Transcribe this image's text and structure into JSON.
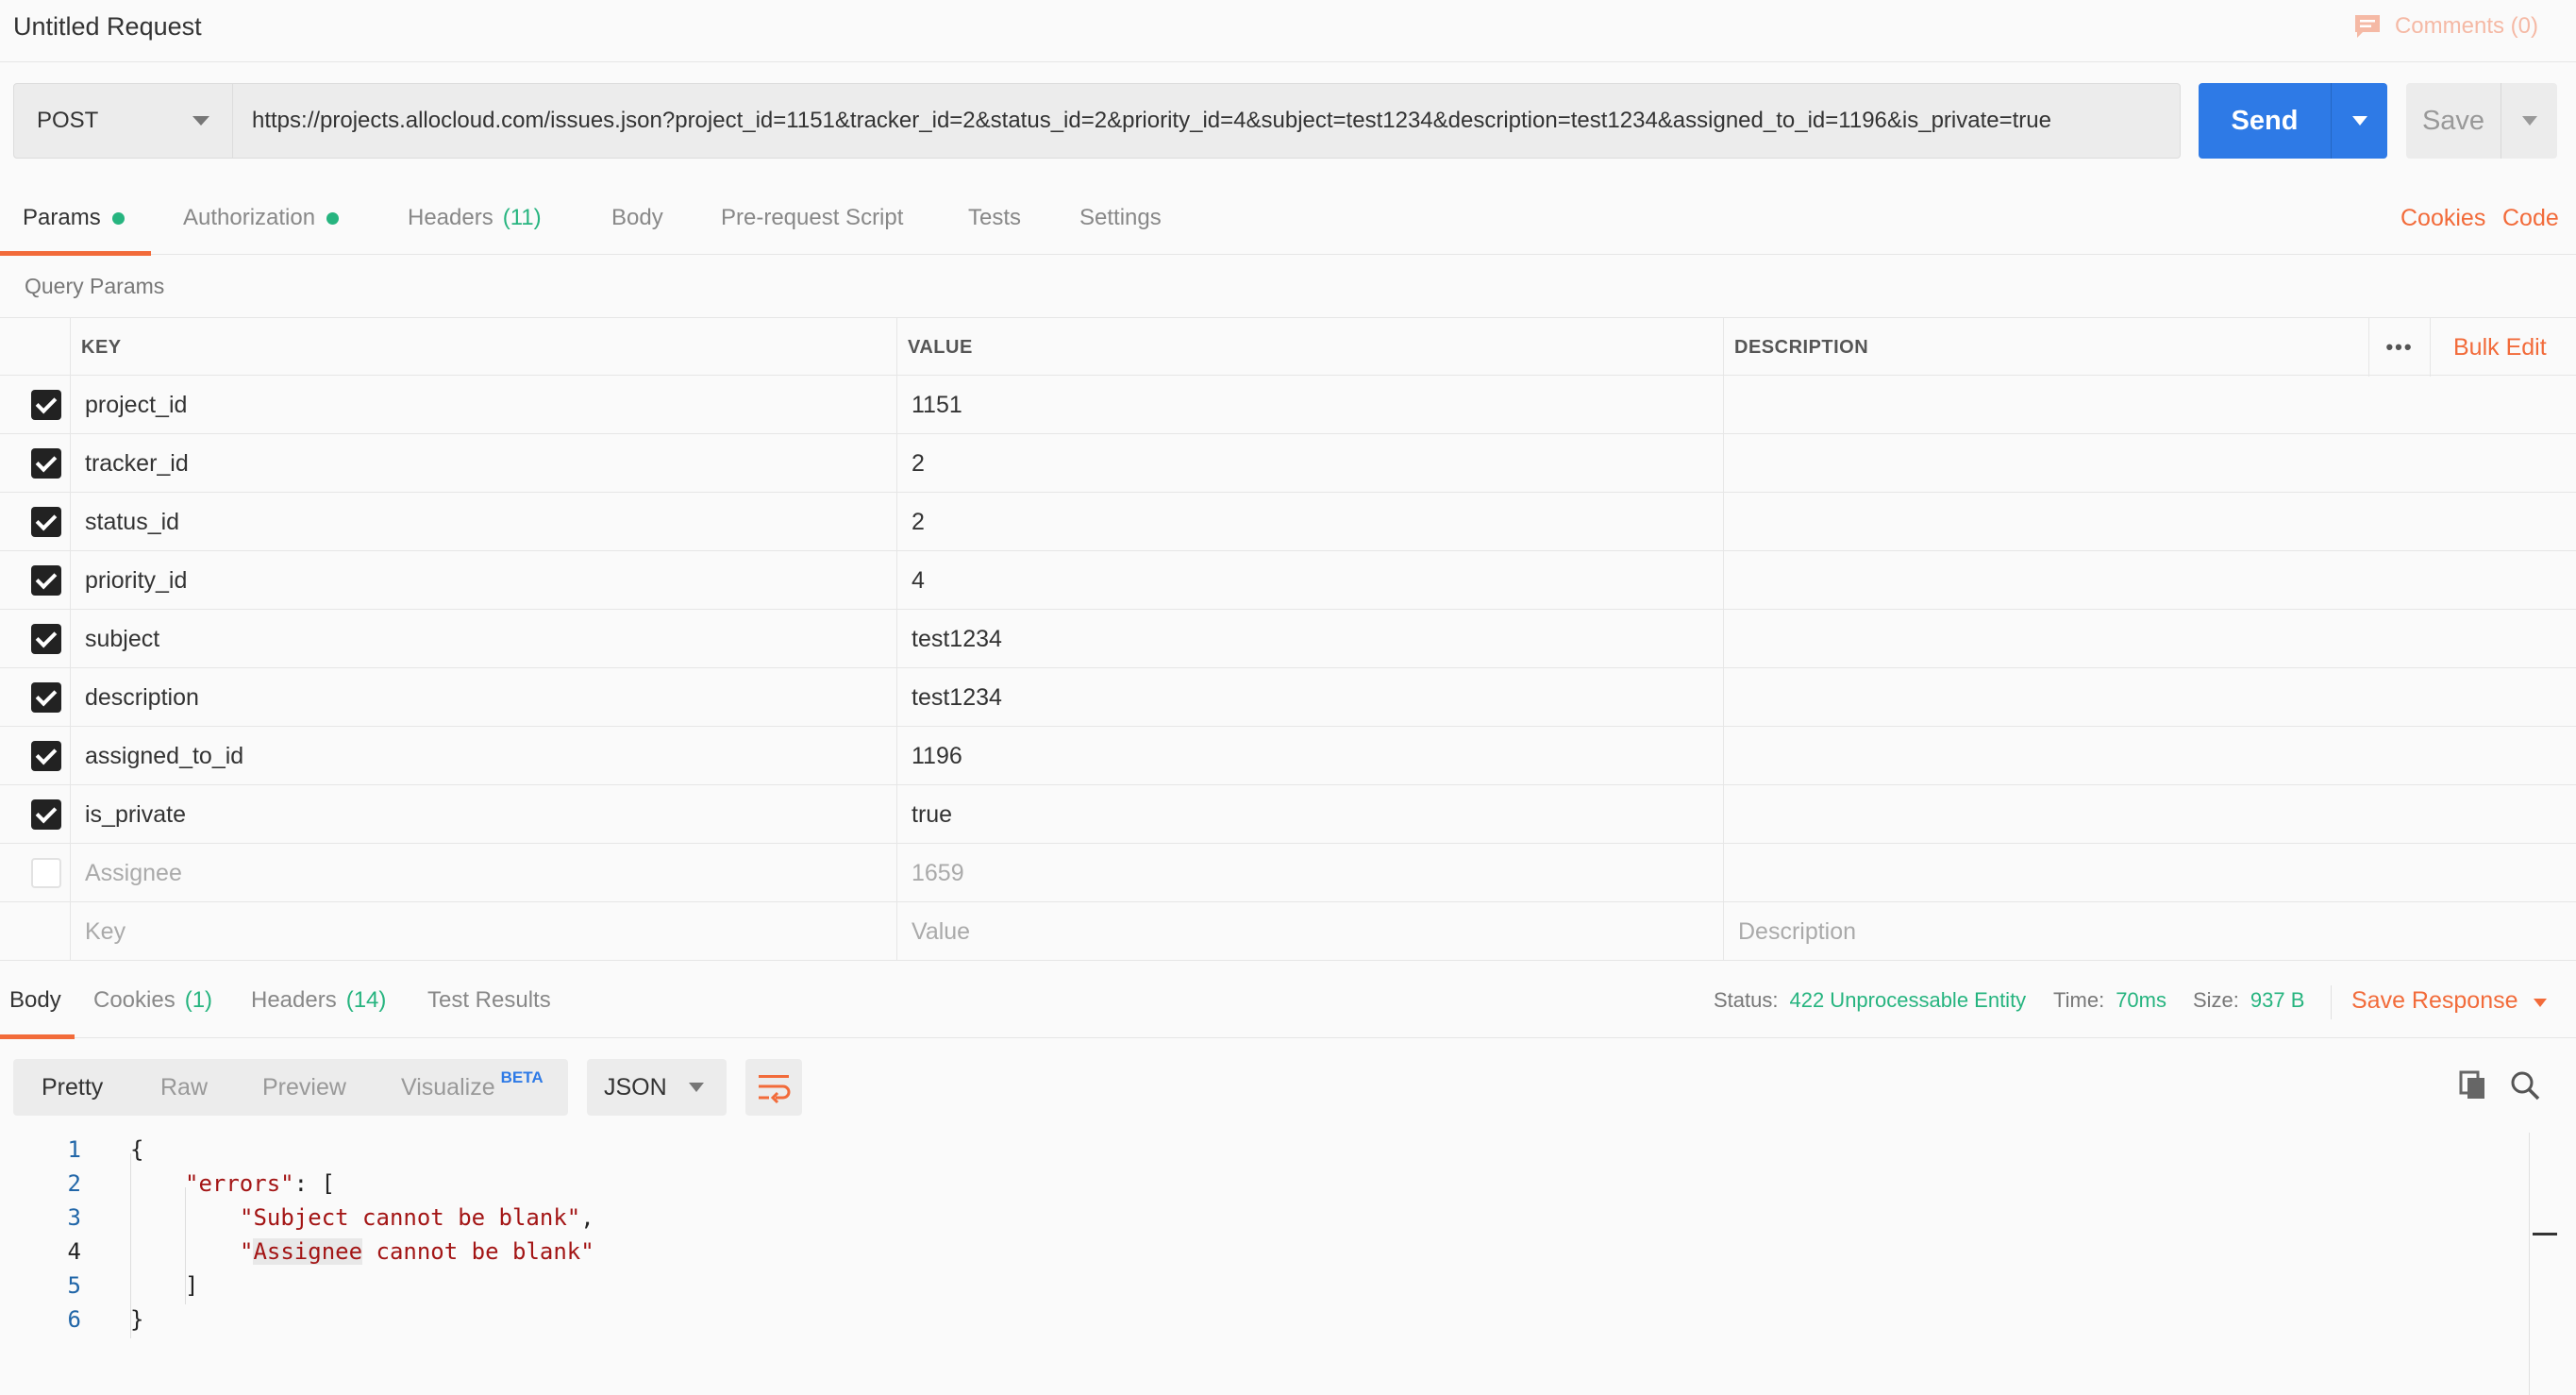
{
  "header": {
    "title": "Untitled Request",
    "comments_label": "Comments (0)"
  },
  "request": {
    "method": "POST",
    "url": "https://projects.allocloud.com/issues.json?project_id=1151&tracker_id=2&status_id=2&priority_id=4&subject=test1234&description=test1234&assigned_to_id=1196&is_private=true",
    "send_label": "Send",
    "save_label": "Save"
  },
  "request_tabs": {
    "params": "Params",
    "authorization": "Authorization",
    "headers": "Headers",
    "headers_count": "(11)",
    "body": "Body",
    "prerequest": "Pre-request Script",
    "tests": "Tests",
    "settings": "Settings",
    "cookies_link": "Cookies",
    "code_link": "Code"
  },
  "params": {
    "section_label": "Query Params",
    "headers": {
      "key": "KEY",
      "value": "VALUE",
      "description": "DESCRIPTION"
    },
    "more_icon": "ellipsis-icon",
    "bulk_edit": "Bulk Edit",
    "rows": [
      {
        "key": "project_id",
        "value": "1151",
        "checked": true
      },
      {
        "key": "tracker_id",
        "value": "2",
        "checked": true
      },
      {
        "key": "status_id",
        "value": "2",
        "checked": true
      },
      {
        "key": "priority_id",
        "value": "4",
        "checked": true
      },
      {
        "key": "subject",
        "value": "test1234",
        "checked": true
      },
      {
        "key": "description",
        "value": "test1234",
        "checked": true
      },
      {
        "key": "assigned_to_id",
        "value": "1196",
        "checked": true
      },
      {
        "key": "is_private",
        "value": "true",
        "checked": true
      },
      {
        "key": "Assignee",
        "value": "1659",
        "checked": false
      }
    ],
    "placeholders": {
      "key": "Key",
      "value": "Value",
      "description": "Description"
    }
  },
  "response_tabs": {
    "body": "Body",
    "cookies": "Cookies",
    "cookies_count": "(1)",
    "headers": "Headers",
    "headers_count": "(14)",
    "test_results": "Test Results"
  },
  "response_status": {
    "status_label": "Status:",
    "status_value": "422 Unprocessable Entity",
    "time_label": "Time:",
    "time_value": "70ms",
    "size_label": "Size:",
    "size_value": "937 B",
    "save_response": "Save Response"
  },
  "response_toolbar": {
    "modes": [
      "Pretty",
      "Raw",
      "Preview",
      "Visualize"
    ],
    "beta_badge": "BETA",
    "format": "JSON"
  },
  "response_body": {
    "line_numbers": [
      "1",
      "2",
      "3",
      "4",
      "5",
      "6"
    ],
    "l1": "{",
    "l2_key": "\"errors\"",
    "l2_rest": ": [",
    "l3_str": "\"Subject cannot be blank\"",
    "l3_rest": ",",
    "l4_quote": "\"",
    "l4_hl": "Assignee",
    "l4_rest": " cannot be blank\"",
    "l5": "]",
    "l6": "}"
  },
  "colors": {
    "accent": "#f26b3a",
    "primary": "#2e7ae6",
    "success": "#26b47f",
    "string": "#a31515"
  }
}
